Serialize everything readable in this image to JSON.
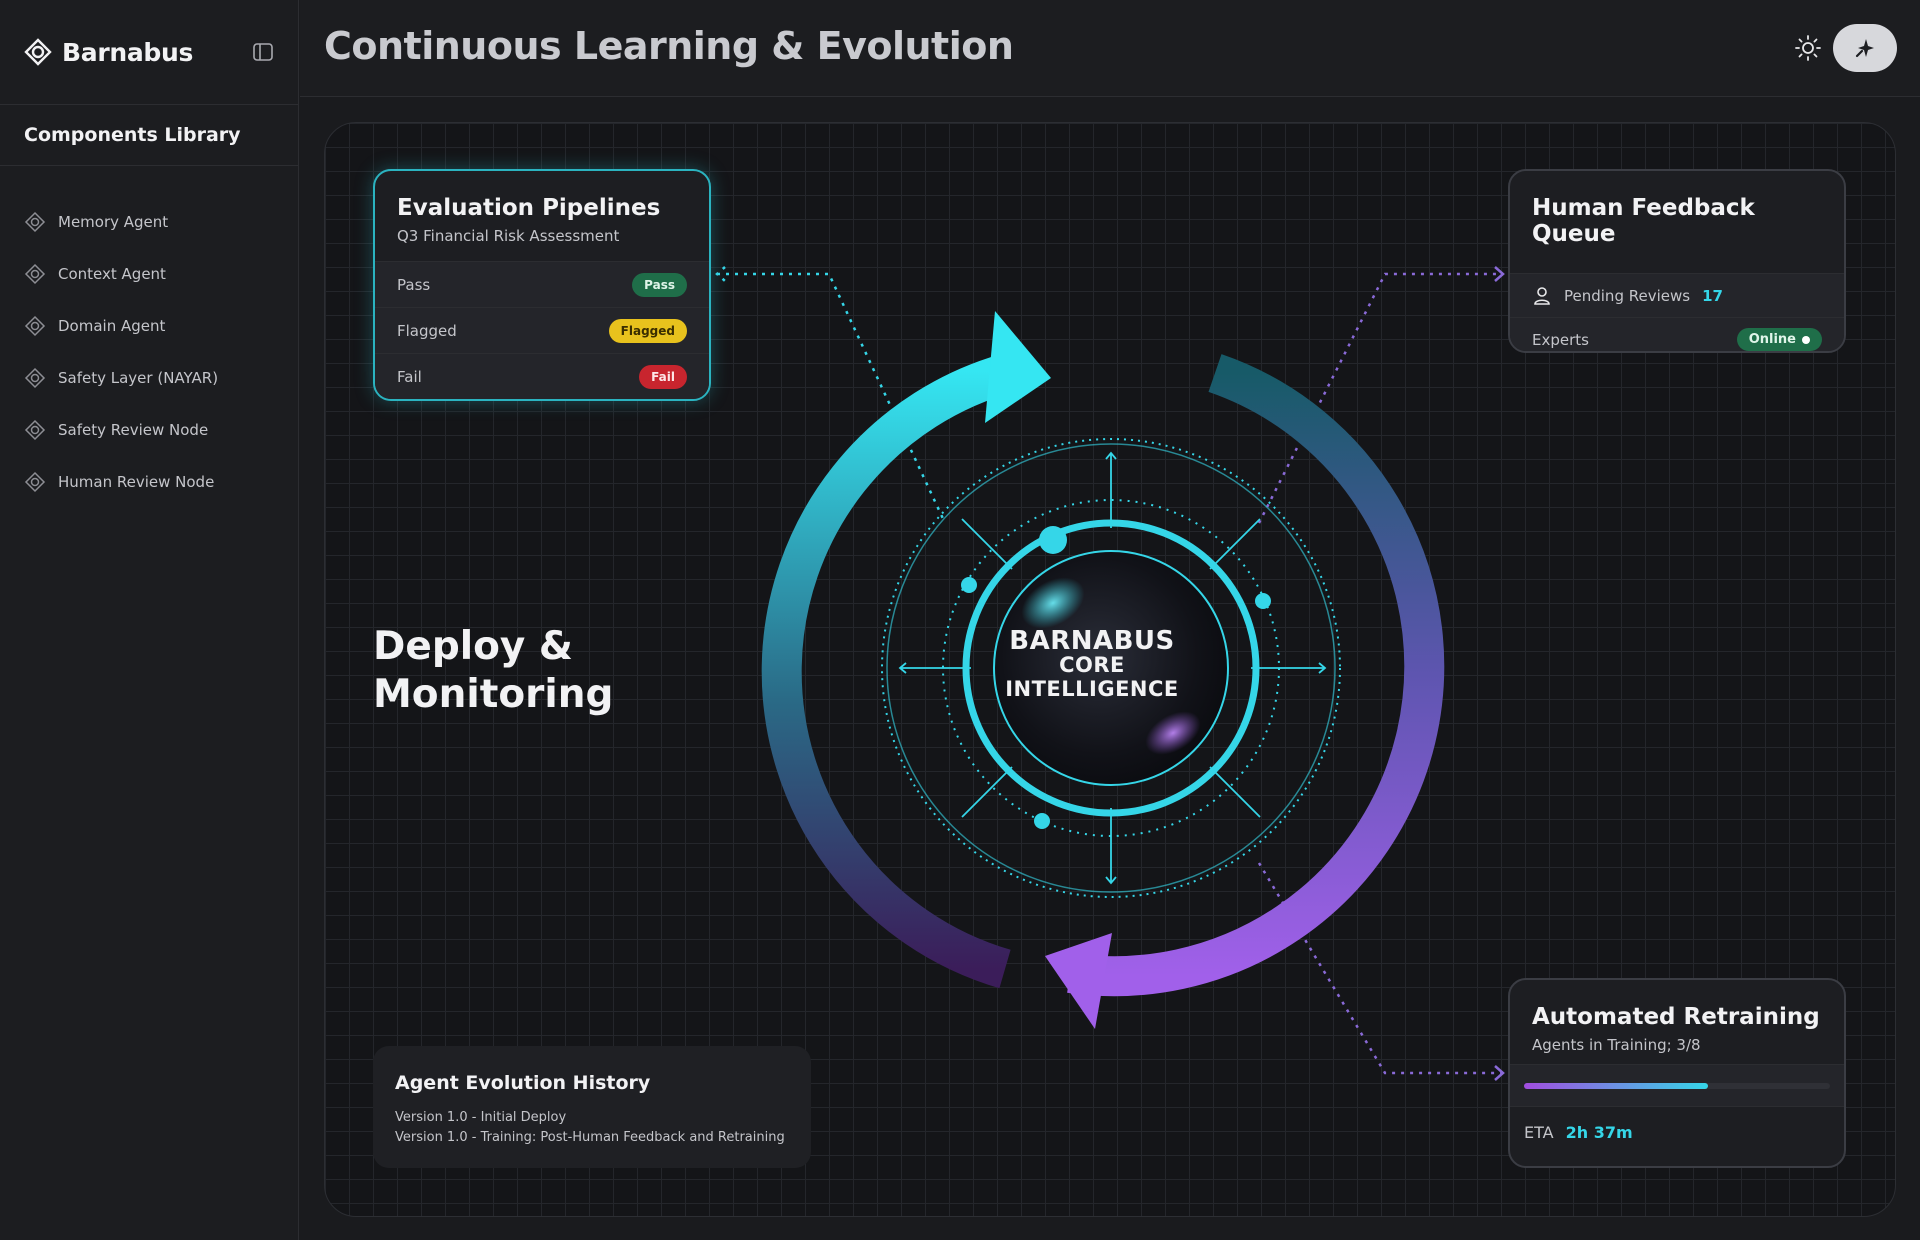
{
  "app": {
    "name": "Barnabus"
  },
  "sidebar": {
    "section_title": "Components Library",
    "items": [
      {
        "label": "Memory Agent"
      },
      {
        "label": "Context Agent"
      },
      {
        "label": "Domain Agent"
      },
      {
        "label": "Safety Layer (NAYAR)"
      },
      {
        "label": "Safety Review Node"
      },
      {
        "label": "Human Review Node"
      }
    ]
  },
  "header": {
    "title": "Continuous Learning & Evolution"
  },
  "evaluation": {
    "title": "Evaluation Pipelines",
    "subtitle": "Q3 Financial Risk Assessment",
    "rows": [
      {
        "label": "Pass",
        "badge": "Pass"
      },
      {
        "label": "Flagged",
        "badge": "Flagged"
      },
      {
        "label": "Fail",
        "badge": "Fail"
      }
    ]
  },
  "human_feedback": {
    "title": "Human Feedback Queue",
    "pending_label": "Pending Reviews",
    "pending_count": "17",
    "experts_label": "Experts",
    "experts_status": "Online"
  },
  "retraining": {
    "title": "Automated Retraining",
    "subtitle": "Agents in Training; 3/8",
    "progress": 0.6,
    "eta_label": "ETA",
    "eta_value": "2h 37m"
  },
  "history": {
    "title": "Agent Evolution History",
    "entries": [
      "Version 1.0 - Initial Deploy",
      "Version 1.0 - Training: Post-Human Feedback and Retraining"
    ]
  },
  "deploy_label": "Deploy & Monitoring",
  "core": {
    "line1": "BARNABUS",
    "line2": "CORE",
    "line3": "INTELLIGENCE"
  },
  "colors": {
    "cyan": "#35d6e8",
    "purple": "#9b5de5",
    "pass": "#1f6e49",
    "flagged": "#e8c21d",
    "fail": "#c8252e"
  }
}
